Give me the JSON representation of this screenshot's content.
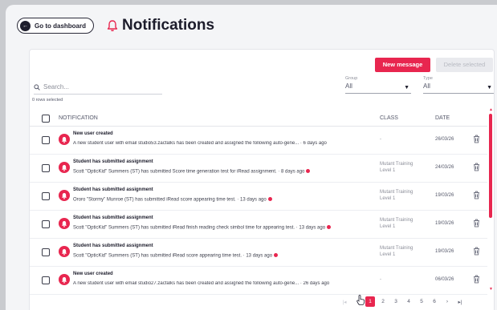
{
  "header": {
    "dashboard_button": "Go to dashboard",
    "title": "Notifications"
  },
  "toolbar": {
    "new_message": "New message",
    "delete_selected": "Delete selected"
  },
  "search": {
    "placeholder": "Search..."
  },
  "filters": {
    "group": {
      "label": "Group",
      "value": "All"
    },
    "type": {
      "label": "Type",
      "value": "All"
    }
  },
  "rows_selected": "0 rows selected",
  "table": {
    "columns": {
      "notification": "NOTIFICATION",
      "class": "CLASS",
      "date": "DATE"
    },
    "rows": [
      {
        "title": "New user created",
        "desc": "A new student user with email studio53.zacfalks has been created and assigned the following auto-gene...",
        "age": " · 6 days ago",
        "dot": false,
        "class": "-",
        "date": "26/03/26"
      },
      {
        "title": "Student has submitted assignment",
        "desc": "Scott \"OpticKid\" Summers (ST) has submitted Score time generation test for iRead assignment.",
        "age": " · 8 days ago",
        "dot": true,
        "class": "Mutant Training\nLevel 1",
        "date": "24/03/26"
      },
      {
        "title": "Student has submitted assignment",
        "desc": "Ororo \"Stormy\" Munroe (ST) has submitted iRead score appearing time test.",
        "age": " · 13 days ago",
        "dot": true,
        "class": "Mutant Training\nLevel 1",
        "date": "19/03/26"
      },
      {
        "title": "Student has submitted assignment",
        "desc": "Scott \"OpticKid\" Summers (ST) has submitted iRead finish reading check simbol time for appearing test.",
        "age": " · 13 days ago",
        "dot": true,
        "class": "Mutant Training\nLevel 1",
        "date": "19/03/26"
      },
      {
        "title": "Student has submitted assignment",
        "desc": "Scott \"OpticKid\" Summers (ST) has submitted iRead score appearing time test.",
        "age": " · 13 days ago",
        "dot": true,
        "class": "Mutant Training\nLevel 1",
        "date": "19/03/26"
      },
      {
        "title": "New user created",
        "desc": "A new student user with email studio27.zacfalks has been created and assigned the following auto-gene...",
        "age": " · 26 days ago",
        "dot": false,
        "class": "-",
        "date": "06/03/26"
      }
    ]
  },
  "pagination": {
    "first": "|◂",
    "prev": "‹",
    "pages": [
      "1",
      "2",
      "3",
      "4",
      "5",
      "6"
    ],
    "current": "1",
    "next": "›",
    "last": "▸|"
  },
  "colors": {
    "accent": "#e8264f",
    "text": "#2b2b3a",
    "muted": "#8c8e99"
  },
  "icons": [
    "arrow-left-icon",
    "bell-icon",
    "search-icon",
    "chevron-down-icon",
    "notification-avatar-icon",
    "trash-icon",
    "hand-cursor-icon"
  ]
}
